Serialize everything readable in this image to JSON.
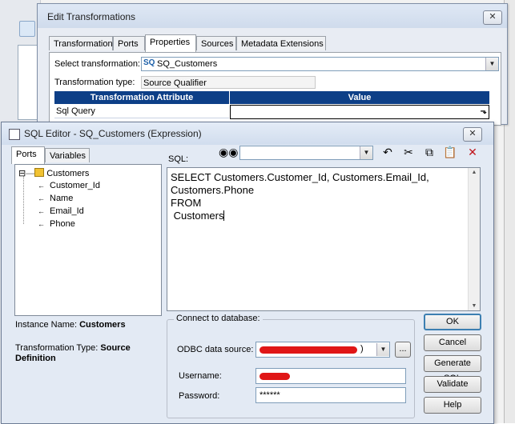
{
  "edit_window": {
    "title": "Edit Transformations",
    "tabs": [
      "Transformation",
      "Ports",
      "Properties",
      "Sources",
      "Metadata Extensions"
    ],
    "active_tab": "Properties",
    "select_transformation_label": "Select transformation:",
    "select_transformation_badge": "SQ",
    "select_transformation_value": "SQ_Customers",
    "transformation_type_label": "Transformation type:",
    "transformation_type_value": "Source Qualifier",
    "grid": {
      "headers": [
        "Transformation Attribute",
        "Value"
      ],
      "rows": [
        {
          "attribute": "Sql Query",
          "value": ""
        }
      ]
    }
  },
  "sql_editor": {
    "title": "SQL Editor - SQ_Customers (Expression)",
    "tabs": [
      "Ports",
      "Variables"
    ],
    "active_tab": "Ports",
    "tree": {
      "root": "Customers",
      "root_toggle": "⊟",
      "ports": [
        "Customer_Id",
        "Name",
        "Email_Id",
        "Phone"
      ]
    },
    "instance_name_label": "Instance Name:",
    "instance_name_value": "Customers",
    "transformation_type_label": "Transformation Type:",
    "transformation_type_value_1": "Source",
    "transformation_type_value_2": "Definition",
    "sql_label": "SQL:",
    "sql_lines": [
      "SELECT Customers.Customer_Id, Customers.Email_Id,",
      "Customers.Phone",
      "FROM",
      " Customers"
    ],
    "toolbar": {
      "find_icon": "binoculars-icon",
      "find_value": "",
      "icons": [
        "undo-icon",
        "cut-icon",
        "copy-icon",
        "paste-icon",
        "delete-icon"
      ]
    },
    "connect": {
      "group_title": "Connect to database:",
      "odbc_label": "ODBC data source:",
      "odbc_value_tail": ")",
      "browse_label": "...",
      "username_label": "Username:",
      "password_label": "Password:",
      "password_value": "******"
    },
    "buttons": {
      "ok": "OK",
      "cancel": "Cancel",
      "generate_sql": "Generate SQL",
      "validate": "Validate",
      "help": "Help"
    }
  },
  "colors": {
    "grid_header": "#0d3f87",
    "redaction": "#e01616",
    "delete_icon": "#c0141a"
  }
}
